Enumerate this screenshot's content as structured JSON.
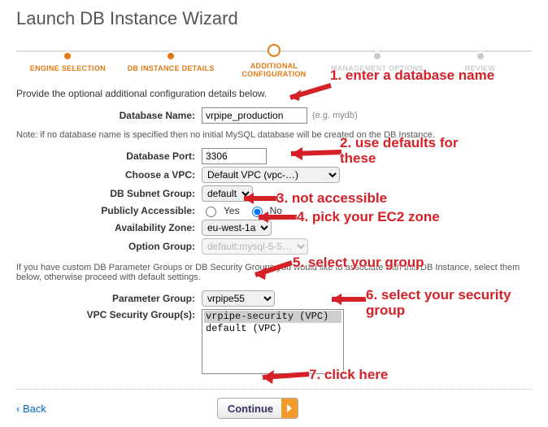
{
  "title": "Launch DB Instance Wizard",
  "steps": {
    "s1": "ENGINE SELECTION",
    "s2": "DB INSTANCE DETAILS",
    "s3": "ADDITIONAL CONFIGURATION",
    "s4": "MANAGEMENT OPTIONS",
    "s5": "REVIEW"
  },
  "intro": "Provide the optional additional configuration details below.",
  "labels": {
    "db_name": "Database Name:",
    "db_port": "Database Port:",
    "vpc": "Choose a VPC:",
    "subnet": "DB Subnet Group:",
    "public": "Publicly Accessible:",
    "az": "Availability Zone:",
    "option_group": "Option Group:",
    "param_group": "Parameter Group:",
    "sec_group": "VPC Security Group(s):"
  },
  "fields": {
    "db_name": "vrpipe_production",
    "db_name_eg": "(e.g. mydb)",
    "db_port": "3306",
    "vpc_options": [
      "Default VPC (vpc-…)"
    ],
    "subnet_options": [
      "default"
    ],
    "public_yes": "Yes",
    "public_no": "No",
    "public_selected": "No",
    "az_options": [
      "eu-west-1a"
    ],
    "option_group_options": [
      "default:mysql-5-5…"
    ],
    "param_group_options": [
      "vrpipe55"
    ],
    "security_groups": [
      "vrpipe-security (VPC)",
      "default (VPC)"
    ]
  },
  "note1": "Note: if no database name is specified then no initial MySQL database will be created on the DB Instance.",
  "note2": "If you have custom DB Parameter Groups or DB Security Groups you would like to associate with this DB Instance, select them below, otherwise proceed with default settings.",
  "footer": {
    "back": "‹ Back",
    "continue": "Continue"
  },
  "annotations": {
    "a1": "1. enter a database name",
    "a2": "2. use defaults for these",
    "a3": "3. not accessible",
    "a4": "4. pick your EC2 zone",
    "a5": "5. select your group",
    "a6": "6. select your security group",
    "a7": "7. click here"
  }
}
